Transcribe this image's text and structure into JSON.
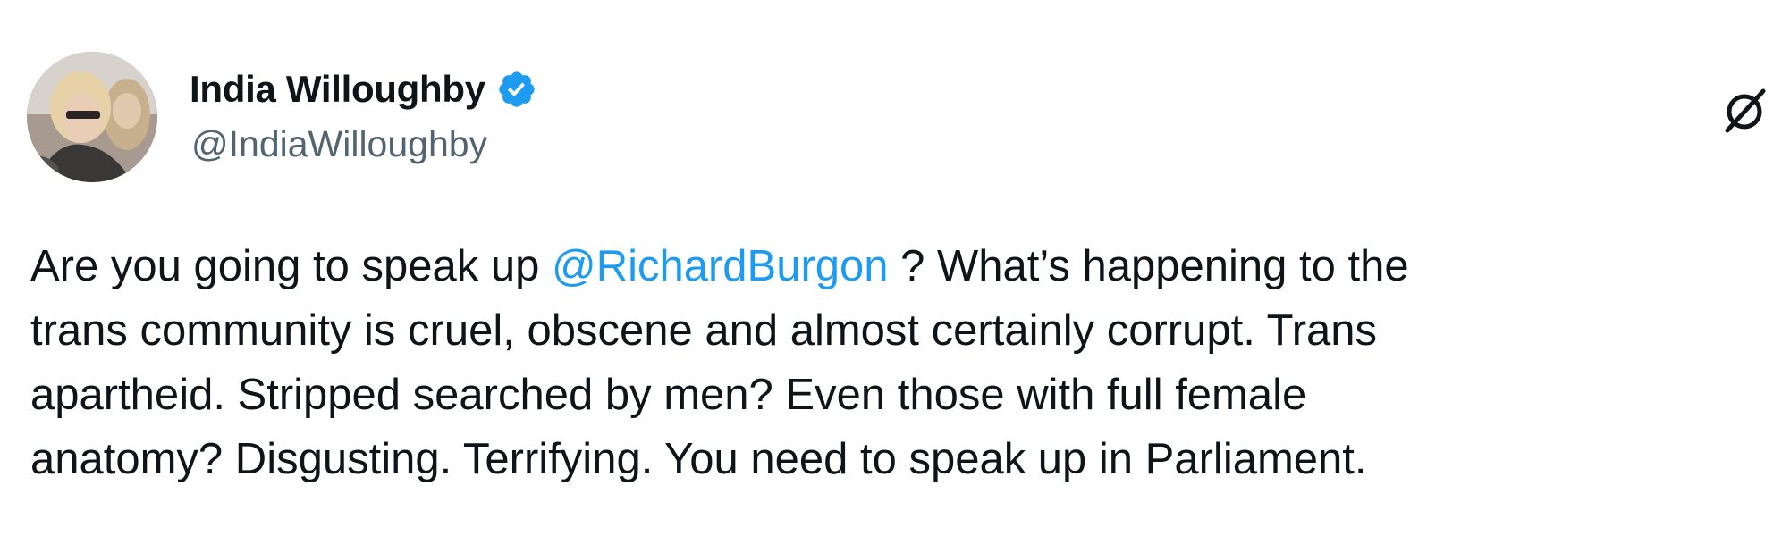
{
  "author": {
    "display_name": "India Willoughby",
    "handle": "@IndiaWilloughby",
    "verified": true
  },
  "icons": {
    "avatar": "profile-photo",
    "verified": "verified-badge-icon",
    "grok": "grok-icon"
  },
  "colors": {
    "text": "#0f1419",
    "secondary": "#536471",
    "mention": "#1d9bf0",
    "verified": "#1d9bf0"
  },
  "tweet": {
    "line1_before": "Are you going to speak up ",
    "mention": "@RichardBurgon",
    "line1_after": " ? What’s happening to the",
    "line2": "trans community is cruel, obscene and almost certainly corrupt. Trans",
    "line3": "apartheid. Stripped searched by men? Even those with full female",
    "line4": "anatomy? Disgusting. Terrifying. You need to speak up in Parliament."
  }
}
